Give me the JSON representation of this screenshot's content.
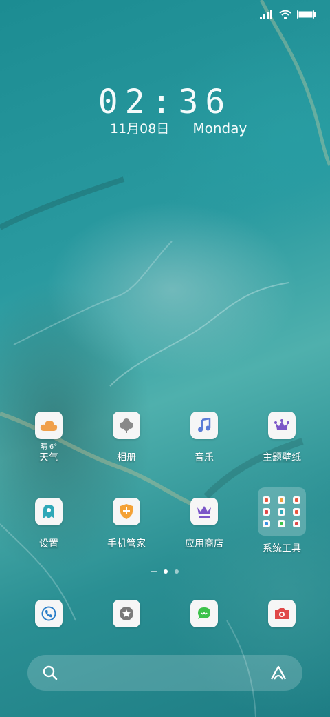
{
  "status_bar": {
    "signal_icon": "signal-icon",
    "wifi_icon": "wifi-icon",
    "battery_icon": "battery-icon"
  },
  "clock": {
    "time": "02:36",
    "date": "11月08日",
    "day": "Monday"
  },
  "weather": {
    "condition": "晴",
    "temperature": "6°"
  },
  "apps_row1": [
    {
      "label": "天气",
      "icon": "weather-cloud-icon",
      "color": "#f0a04b"
    },
    {
      "label": "相册",
      "icon": "clover-icon",
      "color": "#8a8a8a"
    },
    {
      "label": "音乐",
      "icon": "music-note-icon",
      "color": "#5b7cd6"
    },
    {
      "label": "主题壁纸",
      "icon": "crown-icon",
      "color": "#7b56c8"
    }
  ],
  "apps_row2": [
    {
      "label": "设置",
      "icon": "settings-ghost-icon",
      "color": "#2fa8b8"
    },
    {
      "label": "手机管家",
      "icon": "shield-plus-icon",
      "color": "#f4a236"
    },
    {
      "label": "应用商店",
      "icon": "store-crown-icon",
      "color": "#7b56c8"
    },
    {
      "label": "系统工具",
      "icon": "folder-icon",
      "color": "#ffffff"
    }
  ],
  "dock": [
    {
      "icon": "phone-icon",
      "color": "#2a7ec8"
    },
    {
      "icon": "star-badge-icon",
      "color": "#7a7a7a"
    },
    {
      "icon": "message-icon",
      "color": "#3cc24a"
    },
    {
      "icon": "camera-icon",
      "color": "#e04848"
    }
  ],
  "search": {
    "search_icon": "search-icon",
    "assistant_icon": "assistant-icon"
  }
}
